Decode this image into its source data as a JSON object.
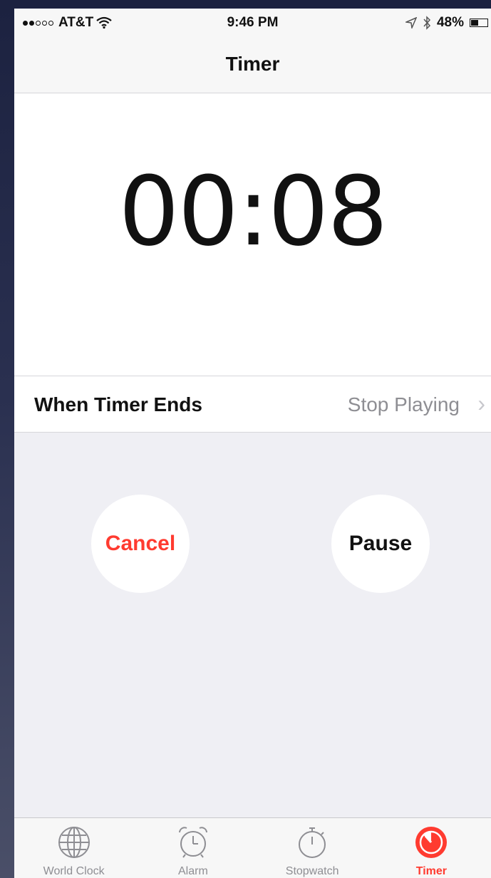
{
  "status_bar": {
    "carrier": "AT&T",
    "time": "9:46 PM",
    "battery_percent": "48%",
    "battery_level": 0.48,
    "signal_strength": 2,
    "signal_max": 5
  },
  "nav": {
    "title": "Timer"
  },
  "timer": {
    "display": "00:08"
  },
  "when_timer_ends": {
    "label": "When Timer Ends",
    "value": "Stop Playing"
  },
  "buttons": {
    "cancel": "Cancel",
    "pause": "Pause"
  },
  "tabs": [
    {
      "label": "World Clock",
      "icon": "globe-icon",
      "active": false
    },
    {
      "label": "Alarm",
      "icon": "alarm-clock-icon",
      "active": false
    },
    {
      "label": "Stopwatch",
      "icon": "stopwatch-icon",
      "active": false
    },
    {
      "label": "Timer",
      "icon": "timer-icon",
      "active": true
    }
  ],
  "colors": {
    "accent": "#ff3b30",
    "secondary_text": "#8e8e93",
    "background": "#efeff4"
  }
}
